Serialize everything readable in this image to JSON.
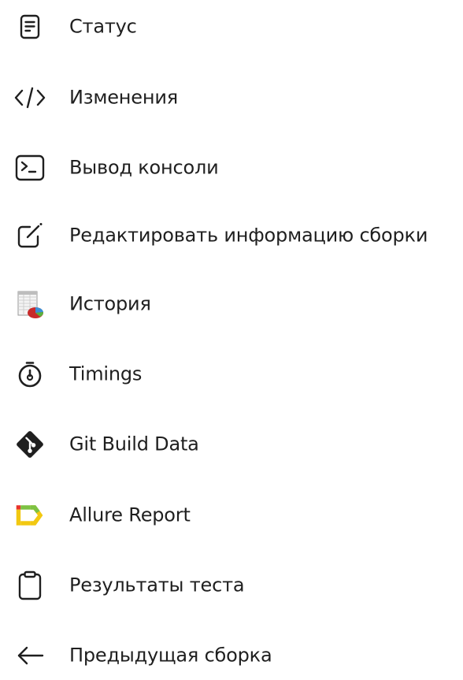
{
  "tasks": [
    {
      "label": "Статус",
      "icon": "document-icon"
    },
    {
      "label": "Изменения",
      "icon": "code-icon"
    },
    {
      "label": "Вывод консоли",
      "icon": "terminal-icon"
    },
    {
      "label": "Редактировать информацию сборки",
      "icon": "edit-icon"
    },
    {
      "label": "История",
      "icon": "history-chart-icon"
    },
    {
      "label": "Timings",
      "icon": "stopwatch-icon"
    },
    {
      "label": "Git Build Data",
      "icon": "git-icon"
    },
    {
      "label": "Allure Report",
      "icon": "allure-icon"
    },
    {
      "label": "Результаты теста",
      "icon": "clipboard-icon"
    },
    {
      "label": "Предыдущая сборка",
      "icon": "arrow-left-icon"
    }
  ],
  "colors": {
    "text": "#1f1f1f",
    "git": "#1f1f1f",
    "allure_red": "#e8332a",
    "allure_yellow": "#f2c811",
    "allure_green": "#7dc243"
  }
}
